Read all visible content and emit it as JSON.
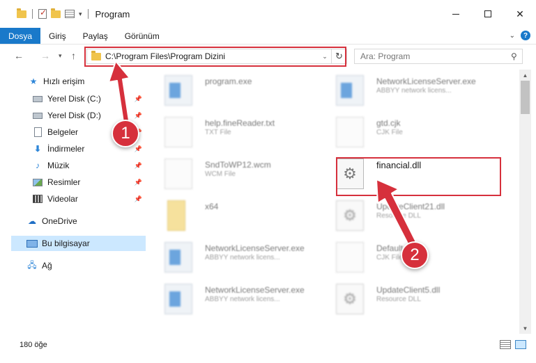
{
  "window": {
    "title": "Program"
  },
  "ribbon": {
    "tabs": [
      "Dosya",
      "Giriş",
      "Paylaş",
      "Görünüm"
    ]
  },
  "address": {
    "path": "C:\\Program Files\\Program Dizini"
  },
  "search": {
    "placeholder": "Ara: Program"
  },
  "sidebar": {
    "items": [
      {
        "label": "Hızlı erişim",
        "icon": "star-icon"
      },
      {
        "label": "Yerel Disk (C:)",
        "icon": "drive-icon",
        "pinned": true
      },
      {
        "label": "Yerel Disk (D:)",
        "icon": "drive-icon",
        "pinned": true
      },
      {
        "label": "Belgeler",
        "icon": "document-icon",
        "pinned": true
      },
      {
        "label": "İndirmeler",
        "icon": "download-icon",
        "pinned": true
      },
      {
        "label": "Müzik",
        "icon": "music-icon",
        "pinned": true
      },
      {
        "label": "Resimler",
        "icon": "pictures-icon",
        "pinned": true
      },
      {
        "label": "Videolar",
        "icon": "videos-icon",
        "pinned": true
      },
      {
        "label": "OneDrive",
        "icon": "cloud-icon"
      },
      {
        "label": "Bu bilgisayar",
        "icon": "computer-icon",
        "selected": true
      },
      {
        "label": "Ağ",
        "icon": "network-icon"
      }
    ]
  },
  "files": [
    {
      "name": "program.exe",
      "type": "",
      "icon": "program-icon"
    },
    {
      "name": "NetworkLicenseServer.exe",
      "type": "ABBYY network licens...",
      "icon": "app-icon"
    },
    {
      "name": "help.fineReader.txt",
      "type": "TXT File",
      "icon": "page-icon"
    },
    {
      "name": "gtd.cjk",
      "type": "CJK File",
      "icon": "page-icon"
    },
    {
      "name": "SndToWP12.wcm",
      "type": "WCM File",
      "icon": "page-icon"
    },
    {
      "name": "financial.dll",
      "type": "",
      "icon": "dll-gear-icon"
    },
    {
      "name": "x64",
      "type": "",
      "icon": "folder-icon"
    },
    {
      "name": "UpdateClient21.dll",
      "type": "Resource DLL",
      "icon": "dll-gear-icon"
    },
    {
      "name": "NetworkLicenseServer.exe",
      "type": "ABBYY network licens...",
      "icon": "app-icon"
    },
    {
      "name": "Default.cjk",
      "type": "CJK File",
      "icon": "page-icon"
    },
    {
      "name": "NetworkLicenseServer.exe",
      "type": "ABBYY network licens...",
      "icon": "app-icon"
    },
    {
      "name": "UpdateClient5.dll",
      "type": "Resource DLL",
      "icon": "dll-gear-icon"
    }
  ],
  "annotations": {
    "step1": "1",
    "step2": "2",
    "color": "#d6303c"
  },
  "status": {
    "count": "180 öğe"
  }
}
